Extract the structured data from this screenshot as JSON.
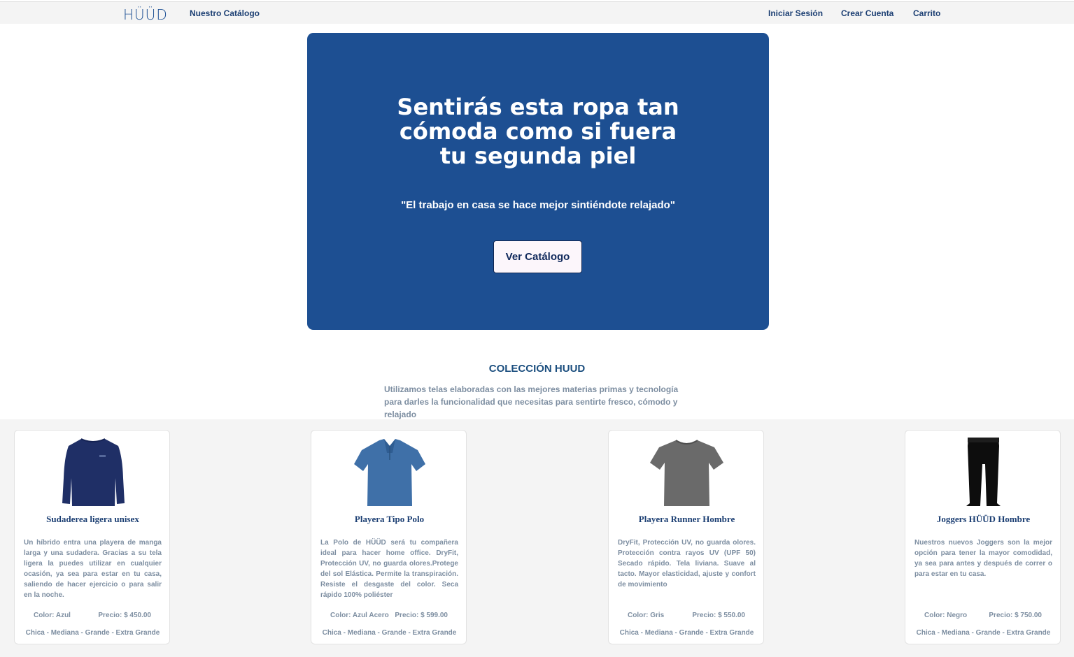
{
  "nav": {
    "logo": "HÜÜD",
    "catalog": "Nuestro Catálogo",
    "login": "Iniciar Sesión",
    "signup": "Crear Cuenta",
    "cart": "Carrito"
  },
  "hero": {
    "title": "Sentirás esta ropa tan cómoda como si fuera tu segunda piel",
    "quote": "\"El trabajo en casa se hace mejor sintiéndote relajado\"",
    "cta": "Ver Catálogo",
    "bg_color": "#1d4f92"
  },
  "collection": {
    "title": "COLECCIÓN HUUD",
    "description": "Utilizamos telas elaboradas con las mejores materias primas y tecnología para darles la funcionalidad que necesitas para sentirte fresco, cómodo y relajado"
  },
  "products": [
    {
      "icon": "sweatshirt-icon",
      "name": "Sudaderea ligera unisex",
      "description": "Un híbrido entra una playera de manga larga y una sudadera. Gracias a su tela ligera la puedes utilizar en cualquier ocasión, ya sea para estar en tu casa, saliendo de hacer ejercicio o para salir en la noche.",
      "color": "Color: Azul",
      "price": "Precio: $ 450.00",
      "sizes": "Chica - Mediana - Grande - Extra Grande"
    },
    {
      "icon": "polo-shirt-icon",
      "name": "Playera Tipo Polo",
      "description": "La Polo de HÜÜD será tu compañera ideal para hacer home office. DryFit, Protección UV, no guarda olores.Protege del sol Elástica. Permite la transpiración. Resiste el desgaste del color. Seca rápido 100% poliéster",
      "color": "Color: Azul Acero",
      "price": "Precio: $ 599.00",
      "sizes": "Chica - Mediana - Grande - Extra Grande"
    },
    {
      "icon": "tshirt-icon",
      "name": "Playera Runner Hombre",
      "description": "DryFit, Protección UV, no guarda olores. Protección contra rayos UV (UPF 50) Secado rápido. Tela liviana. Suave al tacto. Mayor elasticidad, ajuste y confort de movimiento",
      "color": "Color: Gris",
      "price": "Precio: $ 550.00",
      "sizes": "Chica - Mediana - Grande - Extra Grande"
    },
    {
      "icon": "joggers-icon",
      "name": "Joggers HÜÜD Hombre",
      "description": "Nuestros nuevos Joggers son la mejor opción para tener la mayor comodidad, ya sea para antes y después de correr o para estar en tu casa.",
      "color": "Color: Negro",
      "price": "Precio: $ 750.00",
      "sizes": "Chica - Mediana - Grande - Extra Grande"
    }
  ]
}
